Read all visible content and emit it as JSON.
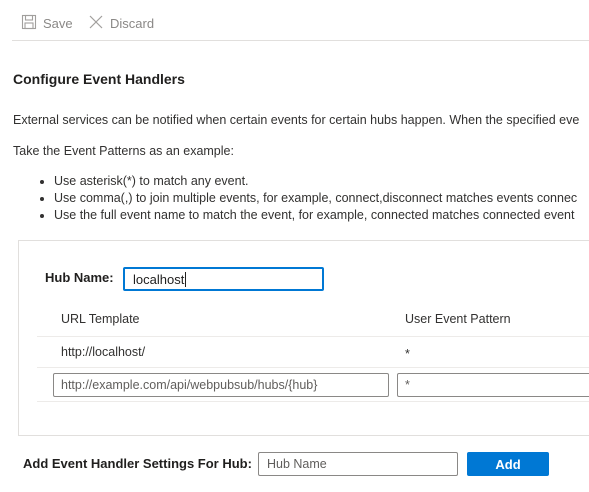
{
  "toolbar": {
    "save_label": "Save",
    "discard_label": "Discard",
    "save_icon": "save-icon",
    "discard_icon": "close-icon"
  },
  "section": {
    "title": "Configure Event Handlers",
    "intro": "External services can be notified when certain events for certain hubs happen. When the specified eve",
    "example_intro": "Take the Event Patterns as an example:",
    "bullets": [
      "Use asterisk(*) to match any event.",
      "Use comma(,) to join multiple events, for example, connect,disconnect matches events connec",
      "Use the full event name to match the event, for example, connected matches connected event"
    ]
  },
  "hub": {
    "label": "Hub Name:",
    "value": "localhost",
    "table": {
      "columns": [
        "URL Template",
        "User Event Pattern"
      ],
      "rows": [
        {
          "url": "http://localhost/",
          "pattern": "*"
        }
      ],
      "new_row": {
        "url_value": "http://example.com/api/webpubsub/hubs/{hub}",
        "pattern_value": "*"
      }
    }
  },
  "footer": {
    "label": "Add Event Handler Settings For Hub:",
    "hub_name_placeholder": "Hub Name",
    "add_label": "Add"
  },
  "colors": {
    "accent": "#0078d4",
    "disabled_text": "#8a8886",
    "border": "#e1dfdd"
  }
}
